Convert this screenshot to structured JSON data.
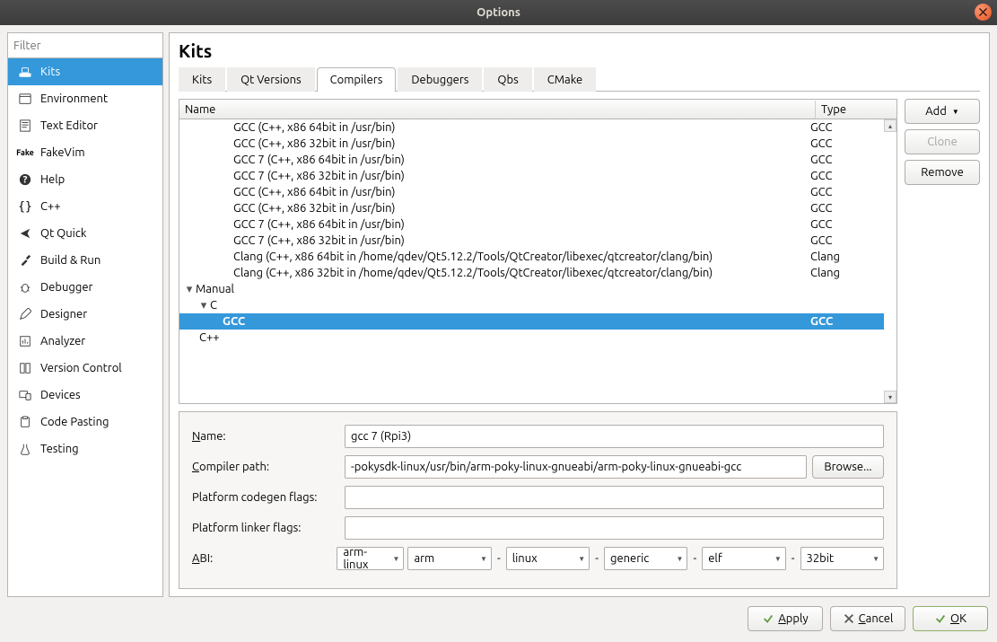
{
  "window": {
    "title": "Options"
  },
  "sidebar": {
    "filter_placeholder": "Filter",
    "items": [
      {
        "label": "Kits"
      },
      {
        "label": "Environment"
      },
      {
        "label": "Text Editor"
      },
      {
        "label": "FakeVim"
      },
      {
        "label": "Help"
      },
      {
        "label": "C++"
      },
      {
        "label": "Qt Quick"
      },
      {
        "label": "Build & Run"
      },
      {
        "label": "Debugger"
      },
      {
        "label": "Designer"
      },
      {
        "label": "Analyzer"
      },
      {
        "label": "Version Control"
      },
      {
        "label": "Devices"
      },
      {
        "label": "Code Pasting"
      },
      {
        "label": "Testing"
      }
    ],
    "selected_index": 0
  },
  "panel": {
    "title": "Kits",
    "tabs": [
      {
        "label": "Kits"
      },
      {
        "label": "Qt Versions"
      },
      {
        "label": "Compilers"
      },
      {
        "label": "Debuggers"
      },
      {
        "label": "Qbs"
      },
      {
        "label": "CMake"
      }
    ],
    "active_tab": 2
  },
  "tree": {
    "columns": {
      "name": "Name",
      "type": "Type"
    },
    "rows": [
      {
        "indent": 3,
        "name": "GCC (C++, x86 64bit in /usr/bin)",
        "type": "GCC"
      },
      {
        "indent": 3,
        "name": "GCC (C++, x86 32bit in /usr/bin)",
        "type": "GCC"
      },
      {
        "indent": 3,
        "name": "GCC 7 (C++, x86 64bit in /usr/bin)",
        "type": "GCC"
      },
      {
        "indent": 3,
        "name": "GCC 7 (C++, x86 32bit in /usr/bin)",
        "type": "GCC"
      },
      {
        "indent": 3,
        "name": "GCC (C++, x86 64bit in /usr/bin)",
        "type": "GCC"
      },
      {
        "indent": 3,
        "name": "GCC (C++, x86 32bit in /usr/bin)",
        "type": "GCC"
      },
      {
        "indent": 3,
        "name": "GCC 7 (C++, x86 64bit in /usr/bin)",
        "type": "GCC"
      },
      {
        "indent": 3,
        "name": "GCC 7 (C++, x86 32bit in /usr/bin)",
        "type": "GCC"
      },
      {
        "indent": 3,
        "name": "Clang (C++, x86 64bit in /home/qdev/Qt5.12.2/Tools/QtCreator/libexec/qtcreator/clang/bin)",
        "type": "Clang"
      },
      {
        "indent": 3,
        "name": "Clang (C++, x86 32bit in /home/qdev/Qt5.12.2/Tools/QtCreator/libexec/qtcreator/clang/bin)",
        "type": "Clang"
      },
      {
        "indent": 0,
        "name": "Manual",
        "type": "",
        "exp": "▾"
      },
      {
        "indent": 1,
        "name": "C",
        "type": "",
        "exp": "▾"
      },
      {
        "indent": 2,
        "name": "GCC",
        "type": "GCC",
        "selected": true
      },
      {
        "indent": 1,
        "name": "C++",
        "type": ""
      }
    ]
  },
  "buttons": {
    "add": "Add",
    "clone": "Clone",
    "remove": "Remove"
  },
  "detail": {
    "name_label": "Name:",
    "name_value": "gcc 7 (Rpi3)",
    "path_label": "Compiler path:",
    "path_value": "-pokysdk-linux/usr/bin/arm-poky-linux-gnueabi/arm-poky-linux-gnueabi-gcc",
    "browse": "Browse...",
    "codegen_label": "Platform codegen flags:",
    "codegen_value": "",
    "linker_label": "Platform linker flags:",
    "linker_value": "",
    "abi_label": "ABI:",
    "abi": {
      "arch": "arm-linux",
      "a1": "arm",
      "a2": "linux",
      "a3": "generic",
      "a4": "elf",
      "a5": "32bit"
    }
  },
  "dialog_buttons": {
    "apply": "Apply",
    "cancel": "Cancel",
    "ok": "OK"
  }
}
